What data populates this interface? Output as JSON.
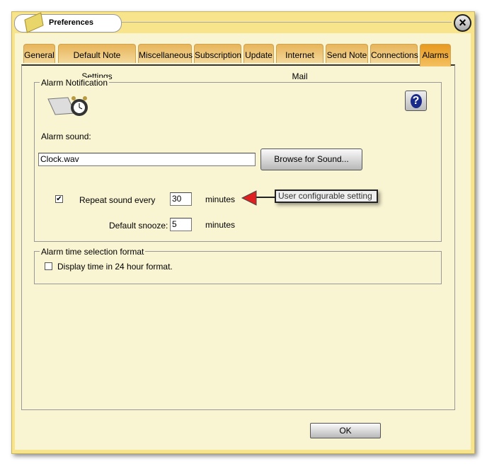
{
  "window": {
    "title": "Preferences",
    "close_icon": "close-icon"
  },
  "tabs": [
    {
      "label": "General"
    },
    {
      "label": "Default Note Settings"
    },
    {
      "label": "Miscellaneous"
    },
    {
      "label": "Subscription"
    },
    {
      "label": "Update"
    },
    {
      "label": "Internet Mail"
    },
    {
      "label": "Send Note"
    },
    {
      "label": "Connections"
    },
    {
      "label": "Alarms",
      "active": true
    }
  ],
  "alarm_notification": {
    "legend": "Alarm Notification",
    "sound_label": "Alarm sound:",
    "sound_value": "Clock.wav",
    "browse_label": "Browse for Sound...",
    "repeat_checked": true,
    "repeat_label": "Repeat sound every",
    "repeat_value": "30",
    "repeat_unit": "minutes",
    "snooze_label": "Default snooze:",
    "snooze_value": "5",
    "snooze_unit": "minutes"
  },
  "callout": {
    "text": "User configurable setting",
    "arrow_color": "#e02020"
  },
  "time_format": {
    "legend": "Alarm time selection format",
    "checkbox_label": "Display time in 24 hour format.",
    "checked": false
  },
  "footer": {
    "ok_label": "OK"
  }
}
